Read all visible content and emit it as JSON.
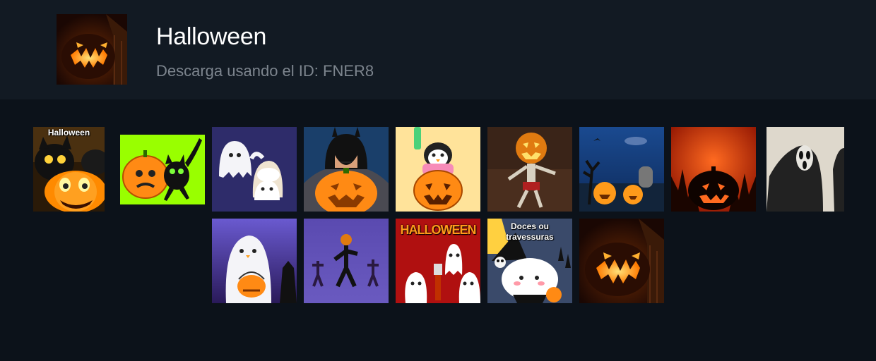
{
  "pack": {
    "title": "Halloween",
    "id_text": "Descarga usando el ID: FNER8"
  },
  "stickers": [
    {
      "name": "cat-pumpkin-halloween",
      "caption": "Halloween"
    },
    {
      "name": "pumpkin-black-cat"
    },
    {
      "name": "two-ghosts"
    },
    {
      "name": "batman-pumpkin"
    },
    {
      "name": "penguin-pumpkin"
    },
    {
      "name": "pumpkin-head-skeleton"
    },
    {
      "name": "graveyard-pumpkins"
    },
    {
      "name": "red-pumpkin-silhouette"
    },
    {
      "name": "ghostface"
    },
    {
      "name": "ghost-candy-bucket"
    },
    {
      "name": "pumpkin-head-dancers"
    },
    {
      "name": "halloween-ghosts",
      "caption": "HALLOWEEN"
    },
    {
      "name": "doces-ou-travessuras-cat",
      "caption": "Doces ou travessuras"
    },
    {
      "name": "carved-pumpkin"
    }
  ]
}
